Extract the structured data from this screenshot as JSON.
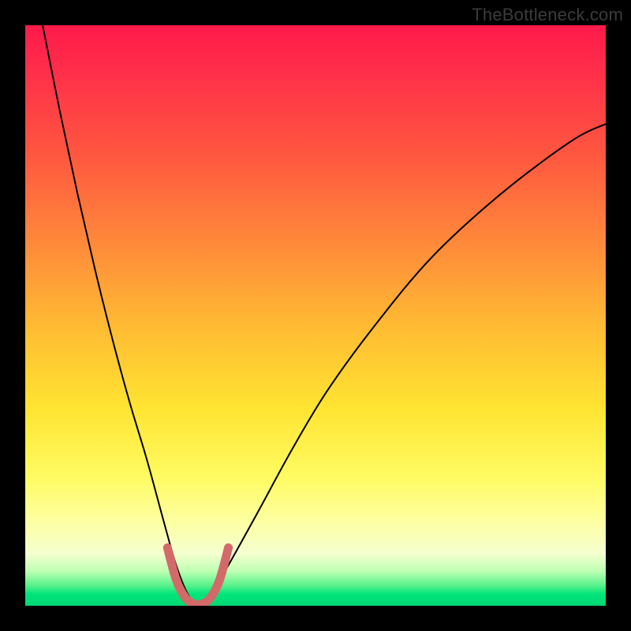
{
  "watermark": "TheBottleneck.com",
  "chart_data": {
    "type": "line",
    "title": "",
    "xlabel": "",
    "ylabel": "",
    "xlim": [
      0,
      100
    ],
    "ylim": [
      0,
      100
    ],
    "grid": false,
    "legend": false,
    "gradient_stops": [
      {
        "pos": 0,
        "color": "#ff1a4a"
      },
      {
        "pos": 8,
        "color": "#ff2f4a"
      },
      {
        "pos": 22,
        "color": "#ff5640"
      },
      {
        "pos": 38,
        "color": "#ff8b3a"
      },
      {
        "pos": 52,
        "color": "#ffbb33"
      },
      {
        "pos": 66,
        "color": "#ffe432"
      },
      {
        "pos": 78,
        "color": "#fffb63"
      },
      {
        "pos": 86,
        "color": "#fdffa6"
      },
      {
        "pos": 91,
        "color": "#f5ffd0"
      },
      {
        "pos": 94,
        "color": "#bfffb3"
      },
      {
        "pos": 96.5,
        "color": "#58f28a"
      },
      {
        "pos": 98,
        "color": "#00e57a"
      },
      {
        "pos": 100,
        "color": "#00d873"
      }
    ],
    "series": [
      {
        "name": "bottleneck-curve",
        "stroke": "#000000",
        "stroke_width": 2,
        "x": [
          3,
          6,
          9,
          12,
          15,
          18,
          21,
          24,
          26,
          28,
          30,
          32,
          35,
          40,
          46,
          52,
          60,
          70,
          82,
          94,
          100
        ],
        "y": [
          100,
          85,
          71,
          58,
          46,
          35,
          25,
          14,
          7,
          2,
          0,
          2,
          7,
          16,
          27,
          37,
          48,
          60,
          71,
          80,
          83
        ]
      },
      {
        "name": "minimum-marker",
        "stroke": "#d36a6a",
        "stroke_width": 11,
        "linecap": "round",
        "x": [
          24.5,
          26,
          27.5,
          29,
          30.5,
          32,
          33.5,
          35
        ],
        "y": [
          10,
          4.5,
          1.5,
          0.3,
          0.3,
          1.5,
          4.5,
          10
        ]
      }
    ],
    "annotations": []
  }
}
